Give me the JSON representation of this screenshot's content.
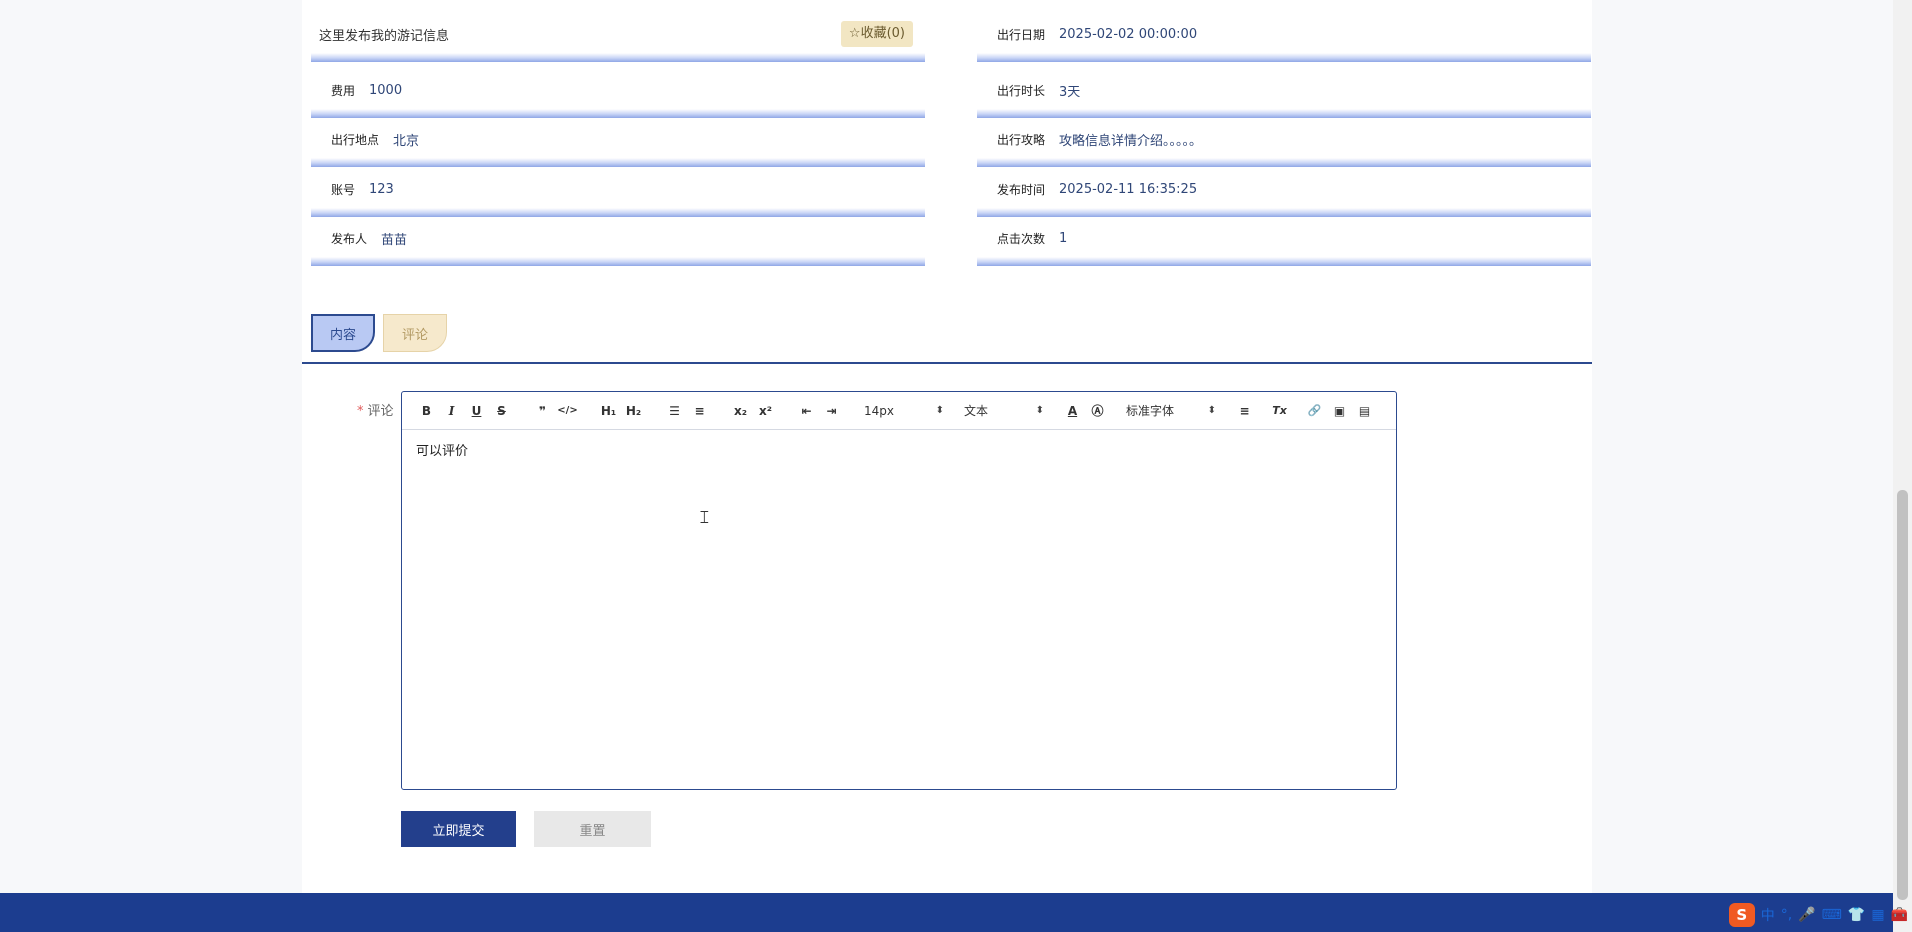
{
  "detail": {
    "title": "这里发布我的游记信息",
    "favorite_label": "☆收藏(0)",
    "left": [
      {
        "label": "费用",
        "value": "1000"
      },
      {
        "label": "出行地点",
        "value": "北京"
      },
      {
        "label": "账号",
        "value": "123"
      },
      {
        "label": "发布人",
        "value": "苗苗"
      }
    ],
    "right": [
      {
        "label": "出行日期",
        "value": "2025-02-02 00:00:00"
      },
      {
        "label": "出行时长",
        "value": "3天"
      },
      {
        "label": "出行攻略",
        "value": "攻略信息详情介绍。。。。。"
      },
      {
        "label": "发布时间",
        "value": "2025-02-11 16:35:25"
      },
      {
        "label": "点击次数",
        "value": "1"
      }
    ]
  },
  "tabs": [
    {
      "label": "内容",
      "active": true
    },
    {
      "label": "评论",
      "active": false
    }
  ],
  "form": {
    "required_mark": "*",
    "comment_label": "评论",
    "editor_content": "可以评价",
    "submit_label": "立即提交",
    "reset_label": "重置"
  },
  "toolbar": {
    "bold": "B",
    "italic": "I",
    "underline": "U",
    "strike": "S",
    "blockquote": "❞",
    "code": "</>",
    "h1": "H₁",
    "h2": "H₂",
    "ordered_list": "☰",
    "bullet_list": "≡",
    "subscript": "x₂",
    "superscript": "x²",
    "outdent": "⇤",
    "indent": "⇥",
    "font_size": "14px",
    "header_select": "文本",
    "color": "A",
    "background": "Ⓐ",
    "font_family": "标准字体",
    "align": "≡",
    "clean": "Tx",
    "link": "🔗",
    "image": "▣",
    "video": "▤"
  },
  "tray": {
    "ime_logo": "S",
    "ime_mode": "中",
    "punct": "°,",
    "icons": [
      "microphone-icon",
      "keyboard-icon",
      "shirt-icon",
      "grid-icon",
      "toolbox-icon"
    ]
  },
  "colors": {
    "accent": "#233f8c",
    "footer": "#1c3d8f",
    "favorite_bg": "#f2e6c3",
    "tab_active_bg": "#b9c9f3",
    "tab_inactive_bg": "#f6e9cc"
  }
}
